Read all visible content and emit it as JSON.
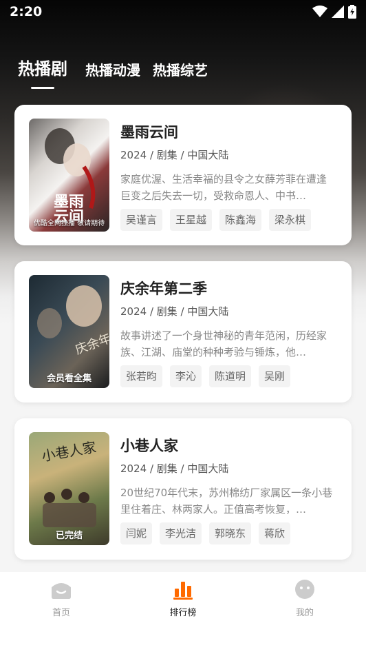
{
  "status_bar": {
    "time": "2:20"
  },
  "tabs": [
    {
      "label": "热播剧",
      "active": true
    },
    {
      "label": "热播动漫",
      "active": false
    },
    {
      "label": "热播综艺",
      "active": false
    }
  ],
  "cards": [
    {
      "title": "墨雨云间",
      "meta": "2024 / 剧集 / 中国大陆",
      "description": "家庭优渥、生活幸福的县令之女薛芳菲在遭逢巨变之后失去一切，受救命恩人、中书…",
      "poster_caption": "优酷全网独播 敬请期待",
      "tags": [
        "吴谨言",
        "王星越",
        "陈鑫海",
        "梁永棋"
      ]
    },
    {
      "title": "庆余年第二季",
      "meta": "2024 / 剧集 / 中国大陆",
      "description": "故事讲述了一个身世神秘的青年范闲，历经家族、江湖、庙堂的种种考验与锤炼，他…",
      "poster_caption": "会员看全集",
      "tags": [
        "张若昀",
        "李沁",
        "陈道明",
        "吴刚"
      ]
    },
    {
      "title": "小巷人家",
      "meta": "2024 / 剧集 / 中国大陆",
      "description": "20世纪70年代末，苏州棉纺厂家属区一条小巷里住着庄、林两家人。正值高考恢复，…",
      "poster_caption": "已完结",
      "tags": [
        "闫妮",
        "李光洁",
        "郭晓东",
        "蒋欣"
      ]
    }
  ],
  "bottom_nav": [
    {
      "label": "首页",
      "icon": "home-icon",
      "active": false
    },
    {
      "label": "排行榜",
      "icon": "ranking-icon",
      "active": true
    },
    {
      "label": "我的",
      "icon": "profile-icon",
      "active": false
    }
  ],
  "colors": {
    "accent": "#ff6a00",
    "inactive": "#cccccc"
  }
}
